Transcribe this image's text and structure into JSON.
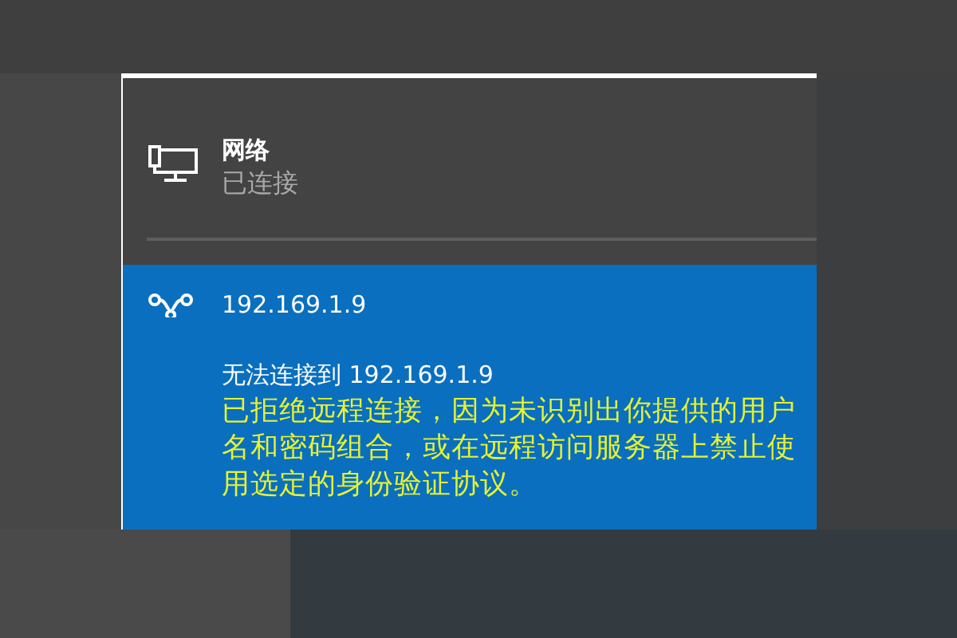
{
  "network": {
    "title": "网络",
    "status": "已连接"
  },
  "connections": [
    {
      "name": "192.169.1.9",
      "selected": true,
      "error_title": "无法连接到 192.169.1.9",
      "error_detail": "已拒绝远程连接，因为未识别出你提供的用户名和密码组合，或在远程访问服务器上禁止使用选定的身份验证协议。"
    }
  ]
}
